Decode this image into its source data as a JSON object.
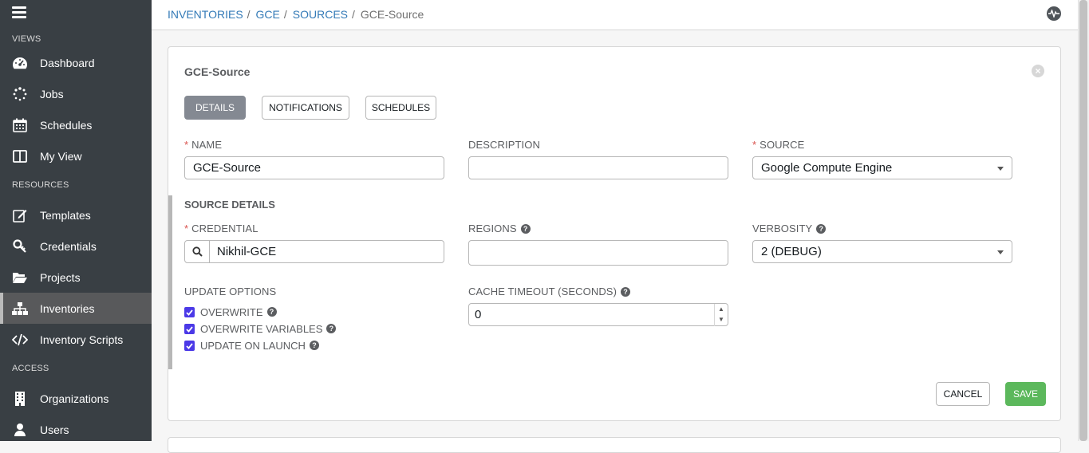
{
  "sidebar": {
    "sections": {
      "views": "VIEWS",
      "resources": "RESOURCES",
      "access": "ACCESS"
    },
    "items": [
      {
        "label": "Dashboard",
        "icon": "dashboard-icon"
      },
      {
        "label": "Jobs",
        "icon": "spinner-icon"
      },
      {
        "label": "Schedules",
        "icon": "calendar-icon"
      },
      {
        "label": "My View",
        "icon": "columns-icon"
      },
      {
        "label": "Templates",
        "icon": "edit-icon"
      },
      {
        "label": "Credentials",
        "icon": "key-icon"
      },
      {
        "label": "Projects",
        "icon": "folder-open-icon"
      },
      {
        "label": "Inventories",
        "icon": "sitemap-icon",
        "active": true
      },
      {
        "label": "Inventory Scripts",
        "icon": "code-icon"
      },
      {
        "label": "Organizations",
        "icon": "building-icon"
      },
      {
        "label": "Users",
        "icon": "user-icon"
      }
    ]
  },
  "breadcrumb": {
    "inventories": "INVENTORIES",
    "gce": "GCE",
    "sources": "SOURCES",
    "current": "GCE-Source",
    "sep": "/"
  },
  "form": {
    "title": "GCE-Source",
    "tabs": {
      "details": "DETAILS",
      "notifications": "NOTIFICATIONS",
      "schedules": "SCHEDULES"
    },
    "name": {
      "label": "NAME",
      "value": "GCE-Source"
    },
    "description": {
      "label": "DESCRIPTION",
      "value": ""
    },
    "source": {
      "label": "SOURCE",
      "value": "Google Compute Engine"
    },
    "source_details": "SOURCE DETAILS",
    "credential": {
      "label": "CREDENTIAL",
      "value": "Nikhil-GCE"
    },
    "regions": {
      "label": "REGIONS",
      "value": ""
    },
    "verbosity": {
      "label": "VERBOSITY",
      "value": "2 (DEBUG)"
    },
    "update_options": {
      "label": "UPDATE OPTIONS",
      "overwrite": "OVERWRITE",
      "overwrite_variables": "OVERWRITE VARIABLES",
      "update_on_launch": "UPDATE ON LAUNCH"
    },
    "cache_timeout": {
      "label": "CACHE TIMEOUT (SECONDS)",
      "value": "0"
    },
    "cancel": "CANCEL",
    "save": "SAVE",
    "close": "×",
    "help": "?"
  },
  "colors": {
    "sidebar_bg": "#393f44",
    "link": "#337ab7",
    "checkbox": "#4b39e7",
    "save": "#5cb85c",
    "required": "#d9534f"
  }
}
